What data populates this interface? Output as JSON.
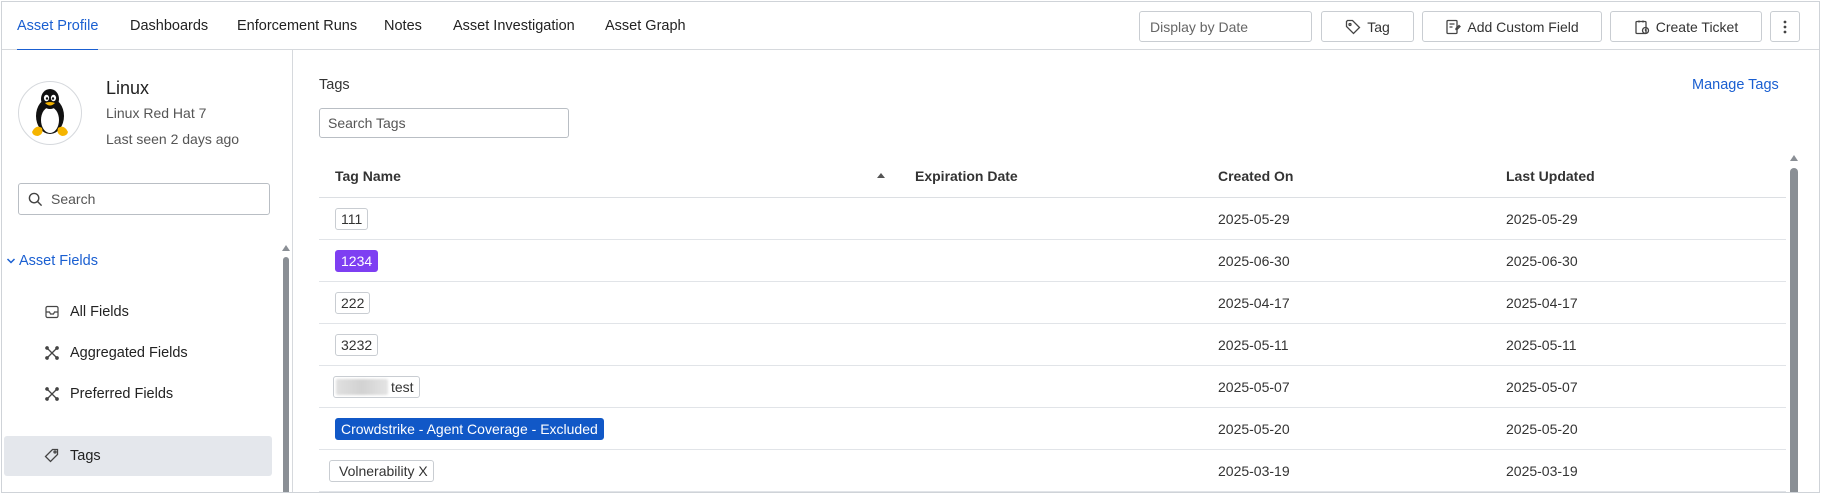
{
  "nav": {
    "tabs": [
      {
        "label": "Asset Profile",
        "active": true
      },
      {
        "label": "Dashboards"
      },
      {
        "label": "Enforcement Runs"
      },
      {
        "label": "Notes"
      },
      {
        "label": "Asset Investigation"
      },
      {
        "label": "Asset Graph"
      }
    ],
    "date_placeholder": "Display by Date",
    "tag_label": "Tag",
    "add_custom_field_label": "Add Custom Field",
    "create_ticket_label": "Create Ticket"
  },
  "asset": {
    "name": "Linux",
    "os": "Linux Red Hat 7",
    "last_seen": "Last seen 2 days ago",
    "avatar_icon": "linux-penguin-icon"
  },
  "sidebar": {
    "search_placeholder": "Search",
    "section_label": "Asset Fields",
    "items": [
      {
        "label": "All Fields",
        "icon": "inbox-icon"
      },
      {
        "label": "Aggregated Fields",
        "icon": "aggregate-icon"
      },
      {
        "label": "Preferred Fields",
        "icon": "aggregate-icon"
      },
      {
        "label": "Tags",
        "icon": "tag-icon",
        "selected": true
      }
    ]
  },
  "tags_panel": {
    "title": "Tags",
    "manage_label": "Manage Tags",
    "search_placeholder": "Search Tags",
    "columns": [
      "Tag Name",
      "Expiration Date",
      "Created On",
      "Last Updated"
    ],
    "rows": [
      {
        "tag": "111",
        "expiration": "",
        "created": "2025-05-29",
        "updated": "2025-05-29"
      },
      {
        "tag": "1234",
        "expiration": "",
        "created": "2025-06-30",
        "updated": "2025-06-30",
        "color": "#7e3ff2"
      },
      {
        "tag": "222",
        "expiration": "",
        "created": "2025-04-17",
        "updated": "2025-04-17"
      },
      {
        "tag": "3232",
        "expiration": "",
        "created": "2025-05-11",
        "updated": "2025-05-11"
      },
      {
        "tag": "test",
        "expiration": "",
        "created": "2025-05-07",
        "updated": "2025-05-07"
      },
      {
        "tag": "Crowdstrike - Agent Coverage - Excluded",
        "expiration": "",
        "created": "2025-05-20",
        "updated": "2025-05-20",
        "color": "#1158c7"
      },
      {
        "tag": "Volnerability X",
        "expiration": "",
        "created": "2025-03-19",
        "updated": "2025-03-19"
      }
    ]
  },
  "colors": {
    "accent": "#1a5fd1",
    "selected_bg": "#e4e7ec"
  }
}
